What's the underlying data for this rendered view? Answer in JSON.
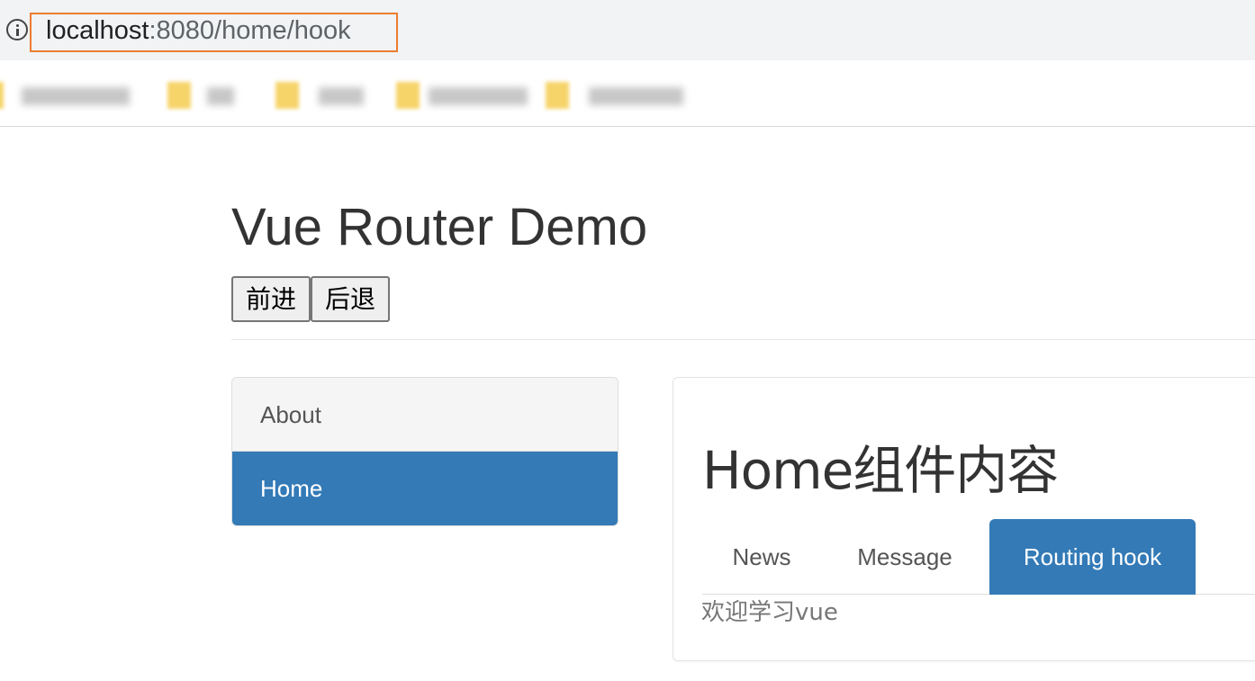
{
  "browser": {
    "url_host": "localhost",
    "url_rest": ":8080/home/hook",
    "highlight_color": "#ed7d31",
    "bookmarks": [
      "",
      "",
      "",
      "",
      ""
    ]
  },
  "page": {
    "title": "Vue Router Demo",
    "forward_label": "前进",
    "back_label": "后退"
  },
  "sidebar": {
    "items": [
      {
        "label": "About",
        "active": false
      },
      {
        "label": "Home",
        "active": true
      }
    ]
  },
  "home": {
    "title": "Home组件内容",
    "tabs": [
      {
        "label": "News",
        "active": false
      },
      {
        "label": "Message",
        "active": false
      },
      {
        "label": "Routing hook",
        "active": true
      }
    ],
    "content": "欢迎学习vue"
  },
  "colors": {
    "primary": "#337ab7",
    "address_bar_bg": "#f1f3f4"
  }
}
